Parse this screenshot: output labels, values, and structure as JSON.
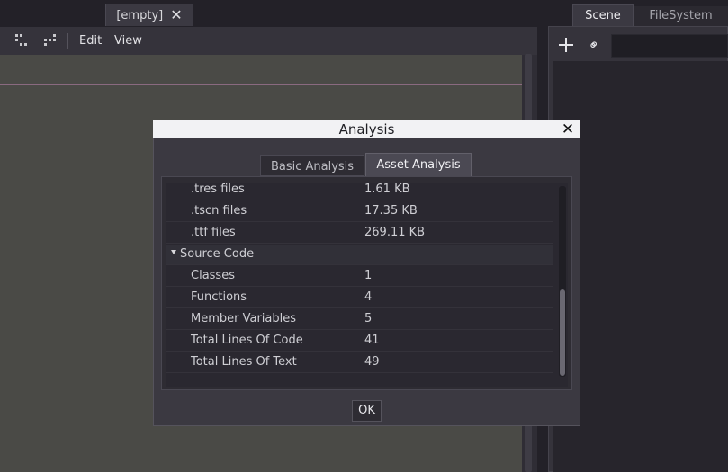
{
  "editor": {
    "scene_tab_label": "[empty]",
    "menu": [
      "Edit",
      "View"
    ]
  },
  "dock": {
    "tabs": [
      "Scene",
      "FileSystem"
    ],
    "filter_value": ""
  },
  "dialog": {
    "title": "Analysis",
    "tabs": [
      "Basic Analysis",
      "Asset Analysis"
    ],
    "active_tab": "Asset Analysis",
    "rows": [
      {
        "name": ".tres files",
        "value": "1.61 KB"
      },
      {
        "name": ".tscn files",
        "value": "17.35 KB"
      },
      {
        "name": ".ttf files",
        "value": "269.11 KB"
      }
    ],
    "section": {
      "title": "Source Code",
      "expanded": true
    },
    "source_rows": [
      {
        "name": "Classes",
        "value": "1"
      },
      {
        "name": "Functions",
        "value": "4"
      },
      {
        "name": "Member Variables",
        "value": "5"
      },
      {
        "name": "Total Lines Of Code",
        "value": "41"
      },
      {
        "name": "Total Lines Of Text",
        "value": "49"
      }
    ],
    "ok_label": "OK"
  },
  "icons": {
    "close": "close-icon",
    "add_node": "plus-icon",
    "link": "link-icon",
    "snap1": "snap-grid-icon",
    "snap2": "snap-smart-icon",
    "caret": "chevron-down-icon"
  },
  "colors": {
    "dialog_title_bar": "#f2f2f4",
    "active_tab": "#4b4953"
  }
}
